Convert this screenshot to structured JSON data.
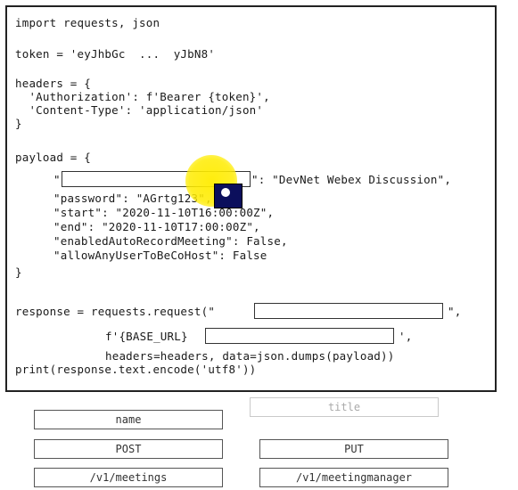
{
  "code": {
    "lines": [
      "import requests, json",
      "token = 'eyJhbGc  ...  yJbN8'",
      "headers = {",
      "  'Authorization': f'Bearer {token}',",
      "  'Content-Type': 'application/json'",
      "}",
      "payload = {",
      "\"",
      "\": \"DevNet Webex Discussion\",",
      "\"password\": \"AGrtg123\",",
      "\"start\": \"2020-11-10T16:00:00Z\",",
      "\"end\": \"2020-11-10T17:00:00Z\",",
      "\"enabledAutoRecordMeeting\": False,",
      "\"allowAnyUserToBeCoHost\": False",
      "}",
      "response = requests.request(\"",
      "\",",
      "f'{BASE_URL}",
      "',",
      "headers=headers, data=json.dumps(payload))",
      "print(response.text.encode('utf8'))"
    ]
  },
  "options": {
    "name": "name",
    "title": "title",
    "post": "POST",
    "put": "PUT",
    "v1_meetings": "/v1/meetings",
    "v1_meetingmanager": "/v1/meetingmanager"
  }
}
